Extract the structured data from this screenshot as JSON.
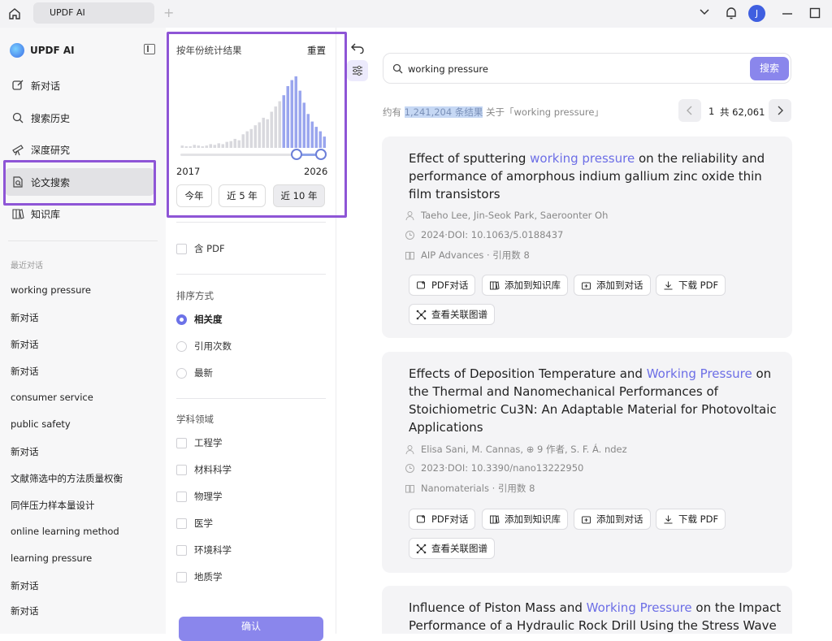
{
  "titlebar": {
    "tab_title": "UPDF AI",
    "add_tab": "+",
    "avatar_letter": "J"
  },
  "sidebar": {
    "brand": "UPDF AI",
    "nav": [
      {
        "label": "新对话",
        "icon": "edit-icon"
      },
      {
        "label": "搜索历史",
        "icon": "search-icon"
      },
      {
        "label": "深度研究",
        "icon": "telescope-icon"
      },
      {
        "label": "论文搜索",
        "icon": "paper-search-icon"
      },
      {
        "label": "知识库",
        "icon": "book-icon"
      }
    ],
    "recent_header": "最近对话",
    "recent": [
      "working pressure",
      "新对话",
      "新对话",
      "新对话",
      "consumer service",
      "public safety",
      "新对话",
      "文献筛选中的方法质量权衡",
      "同伴压力样本量设计",
      "online learning method",
      "learning pressure",
      "新对话",
      "新对话"
    ]
  },
  "filter": {
    "title": "按年份统计结果",
    "reset": "重置",
    "year_start": "2017",
    "year_end": "2026",
    "presets": [
      "今年",
      "近 5 年",
      "近 10 年"
    ],
    "selected_preset": "近 10 年",
    "has_pdf": "含 PDF",
    "sort_header": "排序方式",
    "sort_options": [
      "相关度",
      "引用次数",
      "最新"
    ],
    "sort_selected": "相关度",
    "field_header": "学科领域",
    "fields": [
      "工程学",
      "材料科学",
      "物理学",
      "医学",
      "环境科学",
      "地质学"
    ],
    "confirm": "确认",
    "histogram": [
      3,
      2,
      2,
      4,
      3,
      2,
      3,
      5,
      4,
      6,
      5,
      8,
      9,
      12,
      10,
      18,
      22,
      25,
      30,
      34,
      40,
      38,
      48,
      55,
      62,
      70,
      82,
      90,
      95,
      76,
      60,
      45,
      35,
      28,
      22,
      15
    ]
  },
  "search": {
    "query": "working pressure",
    "button": "搜索"
  },
  "results_info": {
    "prefix": "约有",
    "count": "1,241,204 条结果",
    "suffix": "关于「working pressure」",
    "page": "1",
    "total": "共 62,061"
  },
  "results": [
    {
      "title_parts": [
        "Effect of sputtering ",
        "working pressure",
        " on the reliability and performance of amorphous indium gallium zinc oxide thin film transistors"
      ],
      "authors": "Taeho Lee, Jin-Seok Park, Saeroonter Oh",
      "date_doi": "2024·DOI: 10.1063/5.0188437",
      "journal": "AIP Advances · 引用数 8"
    },
    {
      "title_parts": [
        "Effects of Deposition Temperature and ",
        "Working Pressure",
        " on the Thermal and Nanomechanical Performances of Stoichiometric Cu3N: An Adaptable Material for Photovoltaic Applications"
      ],
      "authors": "Elisa Sani, M. Cannas, ⊕ 9 作者, S. F. Á. ndez",
      "date_doi": "2023·DOI: 10.3390/nano13222950",
      "journal": "Nanomaterials · 引用数 8"
    },
    {
      "title_parts": [
        "Influence of Piston Mass and ",
        "Working Pressure",
        " on the Impact Performance of a Hydraulic Rock Drill Using the Stress Wave"
      ]
    }
  ],
  "actions": {
    "pdf_chat": "PDF对话",
    "add_kb": "添加到知识库",
    "add_chat": "添加到对话",
    "download": "下载 PDF",
    "graph": "查看关联图谱"
  },
  "colors": {
    "accent": "#8a86ec",
    "highlight": "#8e55d6",
    "link": "#6c6ee6"
  }
}
